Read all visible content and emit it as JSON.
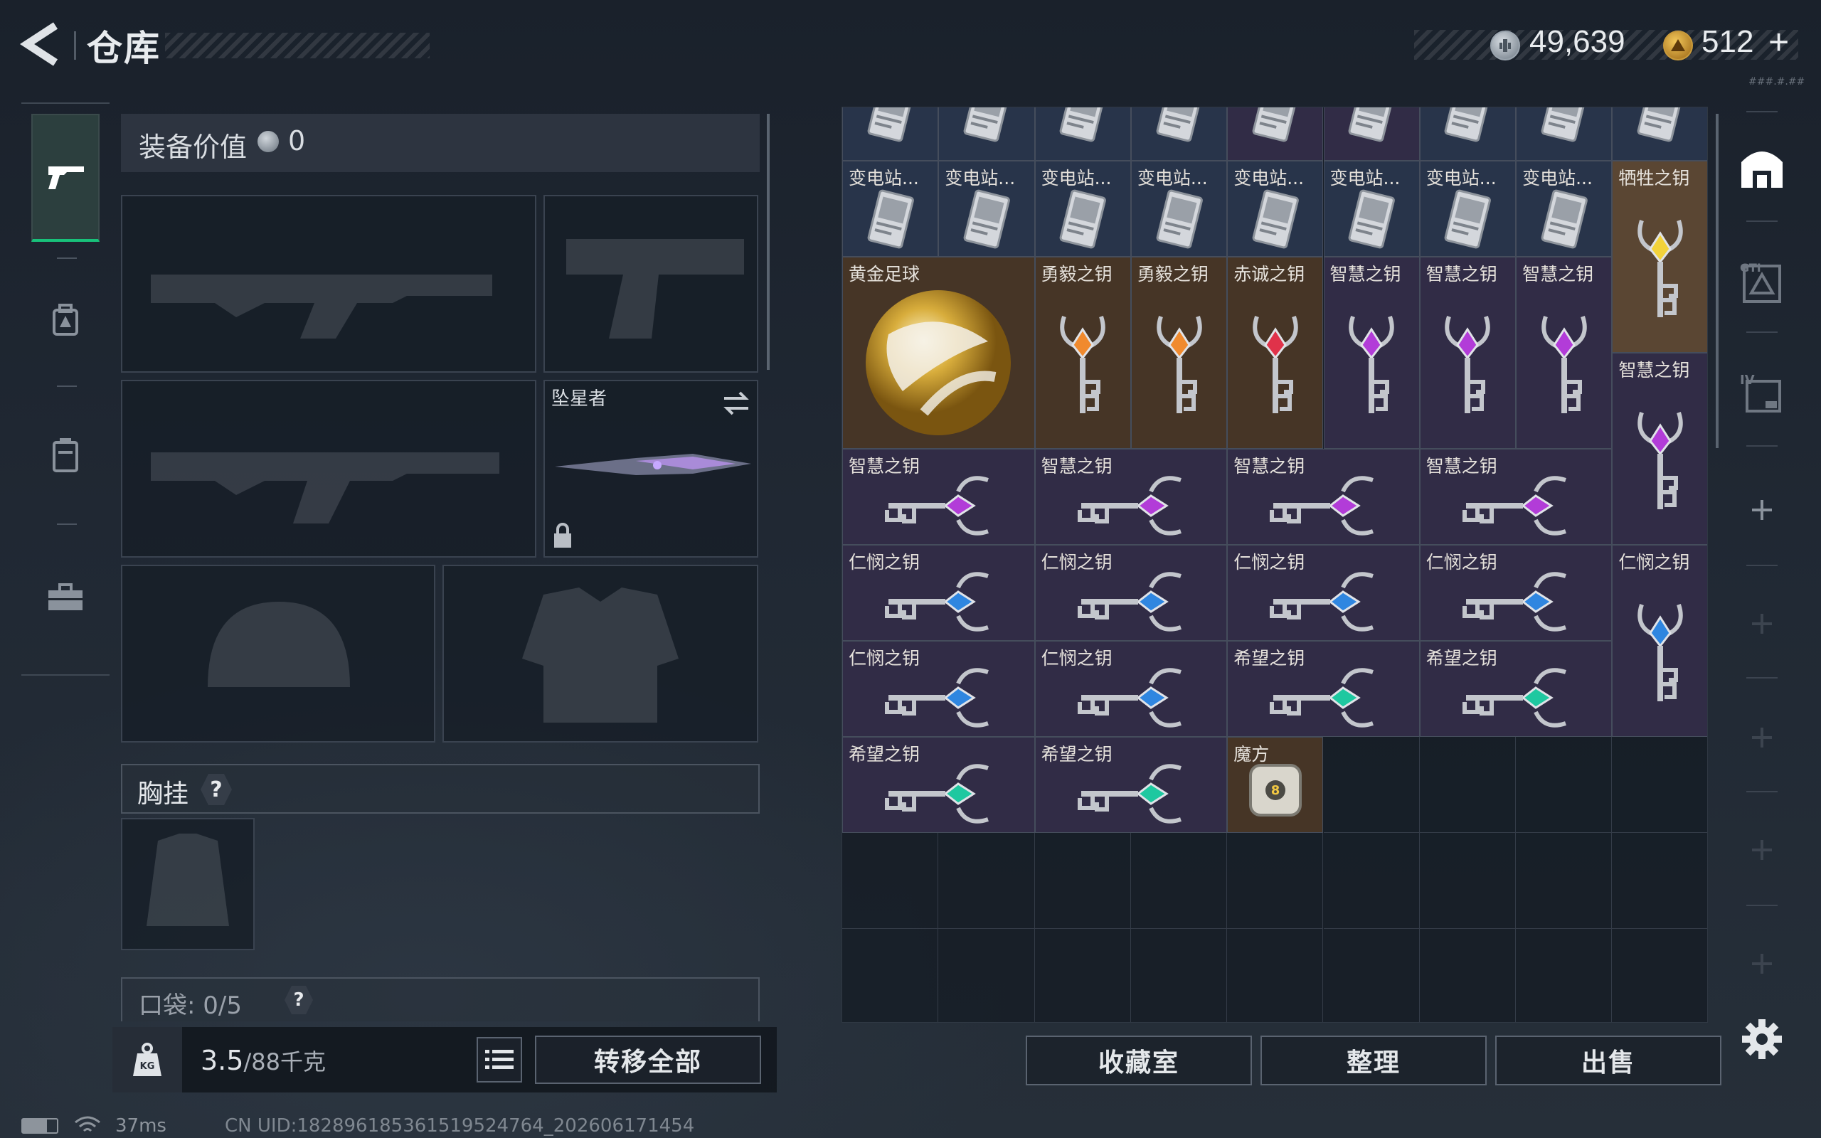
{
  "header": {
    "title": "仓库",
    "currency1": "49,639",
    "currency2": "512",
    "plus": "+",
    "version_text": "###.#.##"
  },
  "left_rail": {
    "tabs": [
      "pistol-icon",
      "backpack-icon",
      "case-icon",
      "toolbox-icon"
    ]
  },
  "equipment": {
    "value_label": "装备价值",
    "value": "0",
    "melee_name": "坠星者",
    "chest_label": "胸挂",
    "chest_help": "?",
    "pocket_label": "口袋: 0/5",
    "pocket_help": "?"
  },
  "weight": {
    "current": "3.5",
    "max": "/88千克"
  },
  "buttons": {
    "transfer_all": "转移全部",
    "collection": "收藏室",
    "sort": "整理",
    "sell": "出售"
  },
  "status": {
    "ping": "37ms",
    "uid": "CN UID:18289618536151952476​4_202606171454"
  },
  "inventory": {
    "columns": 9,
    "items": [
      {
        "name": "",
        "kind": "card",
        "bg": "blue",
        "c": 0,
        "r": 0,
        "w": 1,
        "h": 1
      },
      {
        "name": "",
        "kind": "card",
        "bg": "blue",
        "c": 1,
        "r": 0,
        "w": 1,
        "h": 1
      },
      {
        "name": "",
        "kind": "card",
        "bg": "blue",
        "c": 2,
        "r": 0,
        "w": 1,
        "h": 1
      },
      {
        "name": "",
        "kind": "card",
        "bg": "blue",
        "c": 3,
        "r": 0,
        "w": 1,
        "h": 1
      },
      {
        "name": "",
        "kind": "card",
        "bg": "purple",
        "c": 4,
        "r": 0,
        "w": 1,
        "h": 1
      },
      {
        "name": "",
        "kind": "card",
        "bg": "purple",
        "c": 5,
        "r": 0,
        "w": 1,
        "h": 1
      },
      {
        "name": "",
        "kind": "card",
        "bg": "blue",
        "c": 6,
        "r": 0,
        "w": 1,
        "h": 1
      },
      {
        "name": "",
        "kind": "card",
        "bg": "blue",
        "c": 7,
        "r": 0,
        "w": 1,
        "h": 1
      },
      {
        "name": "",
        "kind": "card",
        "bg": "blue",
        "c": 8,
        "r": 0,
        "w": 1,
        "h": 1
      },
      {
        "name": "变电站...",
        "kind": "card",
        "bg": "blue",
        "c": 0,
        "r": 1,
        "w": 1,
        "h": 1
      },
      {
        "name": "变电站...",
        "kind": "card",
        "bg": "blue",
        "c": 1,
        "r": 1,
        "w": 1,
        "h": 1
      },
      {
        "name": "变电站...",
        "kind": "card",
        "bg": "blue",
        "c": 2,
        "r": 1,
        "w": 1,
        "h": 1
      },
      {
        "name": "变电站...",
        "kind": "card",
        "bg": "blue",
        "c": 3,
        "r": 1,
        "w": 1,
        "h": 1
      },
      {
        "name": "变电站...",
        "kind": "card",
        "bg": "blue",
        "c": 4,
        "r": 1,
        "w": 1,
        "h": 1
      },
      {
        "name": "变电站...",
        "kind": "card",
        "bg": "blue",
        "c": 5,
        "r": 1,
        "w": 1,
        "h": 1
      },
      {
        "name": "变电站...",
        "kind": "card",
        "bg": "blue",
        "c": 6,
        "r": 1,
        "w": 1,
        "h": 1
      },
      {
        "name": "变电站...",
        "kind": "card",
        "bg": "blue",
        "c": 7,
        "r": 1,
        "w": 1,
        "h": 1
      },
      {
        "name": "牺牲之钥",
        "kind": "key-v",
        "gem": "#f2d23a",
        "bg": "orange",
        "c": 8,
        "r": 1,
        "w": 1,
        "h": 2
      },
      {
        "name": "黄金足球",
        "kind": "ball",
        "bg": "brown",
        "c": 0,
        "r": 2,
        "w": 2,
        "h": 2
      },
      {
        "name": "勇毅之钥",
        "kind": "key-v",
        "gem": "#f08a2e",
        "bg": "brown",
        "c": 2,
        "r": 2,
        "w": 1,
        "h": 2
      },
      {
        "name": "勇毅之钥",
        "kind": "key-v",
        "gem": "#f08a2e",
        "bg": "brown",
        "c": 3,
        "r": 2,
        "w": 1,
        "h": 2
      },
      {
        "name": "赤诚之钥",
        "kind": "key-v",
        "gem": "#e0324a",
        "bg": "brown",
        "c": 4,
        "r": 2,
        "w": 1,
        "h": 2
      },
      {
        "name": "智慧之钥",
        "kind": "key-v",
        "gem": "#b23cd8",
        "bg": "purple",
        "c": 5,
        "r": 2,
        "w": 1,
        "h": 2
      },
      {
        "name": "智慧之钥",
        "kind": "key-v",
        "gem": "#b23cd8",
        "bg": "purple",
        "c": 6,
        "r": 2,
        "w": 1,
        "h": 2
      },
      {
        "name": "智慧之钥",
        "kind": "key-v",
        "gem": "#b23cd8",
        "bg": "purple",
        "c": 7,
        "r": 2,
        "w": 1,
        "h": 2
      },
      {
        "name": "智慧之钥",
        "kind": "key-v",
        "gem": "#b23cd8",
        "bg": "purple",
        "c": 8,
        "r": 3,
        "w": 1,
        "h": 2
      },
      {
        "name": "智慧之钥",
        "kind": "key-h",
        "gem": "#b23cd8",
        "bg": "purple",
        "c": 0,
        "r": 4,
        "w": 2,
        "h": 1
      },
      {
        "name": "智慧之钥",
        "kind": "key-h",
        "gem": "#b23cd8",
        "bg": "purple",
        "c": 2,
        "r": 4,
        "w": 2,
        "h": 1
      },
      {
        "name": "智慧之钥",
        "kind": "key-h",
        "gem": "#b23cd8",
        "bg": "purple",
        "c": 4,
        "r": 4,
        "w": 2,
        "h": 1
      },
      {
        "name": "智慧之钥",
        "kind": "key-h",
        "gem": "#b23cd8",
        "bg": "purple",
        "c": 6,
        "r": 4,
        "w": 2,
        "h": 1
      },
      {
        "name": "仁悯之钥",
        "kind": "key-h",
        "gem": "#2f86e0",
        "bg": "purple",
        "c": 0,
        "r": 5,
        "w": 2,
        "h": 1
      },
      {
        "name": "仁悯之钥",
        "kind": "key-h",
        "gem": "#2f86e0",
        "bg": "purple",
        "c": 2,
        "r": 5,
        "w": 2,
        "h": 1
      },
      {
        "name": "仁悯之钥",
        "kind": "key-h",
        "gem": "#2f86e0",
        "bg": "purple",
        "c": 4,
        "r": 5,
        "w": 2,
        "h": 1
      },
      {
        "name": "仁悯之钥",
        "kind": "key-h",
        "gem": "#2f86e0",
        "bg": "purple",
        "c": 6,
        "r": 5,
        "w": 2,
        "h": 1
      },
      {
        "name": "仁悯之钥",
        "kind": "key-v",
        "gem": "#2f86e0",
        "bg": "purple",
        "c": 8,
        "r": 5,
        "w": 1,
        "h": 2
      },
      {
        "name": "仁悯之钥",
        "kind": "key-h",
        "gem": "#2f86e0",
        "bg": "purple",
        "c": 0,
        "r": 6,
        "w": 2,
        "h": 1
      },
      {
        "name": "仁悯之钥",
        "kind": "key-h",
        "gem": "#2f86e0",
        "bg": "purple",
        "c": 2,
        "r": 6,
        "w": 2,
        "h": 1
      },
      {
        "name": "希望之钥",
        "kind": "key-h",
        "gem": "#1ec8a0",
        "bg": "purple",
        "c": 4,
        "r": 6,
        "w": 2,
        "h": 1
      },
      {
        "name": "希望之钥",
        "kind": "key-h",
        "gem": "#1ec8a0",
        "bg": "purple",
        "c": 6,
        "r": 6,
        "w": 2,
        "h": 1
      },
      {
        "name": "希望之钥",
        "kind": "key-h",
        "gem": "#1ec8a0",
        "bg": "purple",
        "c": 0,
        "r": 7,
        "w": 2,
        "h": 1
      },
      {
        "name": "希望之钥",
        "kind": "key-h",
        "gem": "#1ec8a0",
        "bg": "purple",
        "c": 2,
        "r": 7,
        "w": 2,
        "h": 1
      },
      {
        "name": "魔方",
        "kind": "cube",
        "bg": "brown",
        "c": 4,
        "r": 7,
        "w": 1,
        "h": 1
      }
    ]
  },
  "right_rail": {
    "icons": [
      "safehouse-icon",
      "gtd-icon",
      "level4-icon",
      "add-slot-icon",
      "add-slot-icon",
      "add-slot-icon",
      "add-slot-icon",
      "add-slot-icon",
      "settings-icon"
    ]
  }
}
